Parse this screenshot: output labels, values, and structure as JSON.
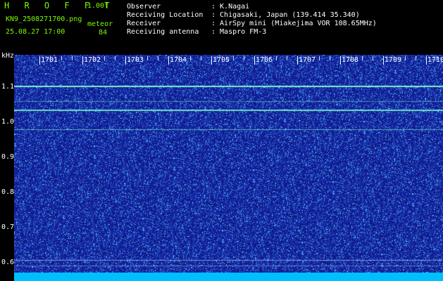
{
  "header": {
    "app_title": "H R O F F T",
    "version": "1.00f",
    "filename": "KN9_2508271700.png",
    "datetime": "25.08.27 17:00",
    "meteor_label": "meteor",
    "meteor_count": "84",
    "info": [
      {
        "label": "Observer",
        "value": ": K.Nagai"
      },
      {
        "label": "Receiving Location",
        "value": ": Chigasaki, Japan (139.414 35.340)"
      },
      {
        "label": "Receiver",
        "value": ": AirSpy mini (Miakejima VOR 108.65MHz)"
      },
      {
        "label": "Receiving antenna",
        "value": ": Maspro FM-3"
      }
    ]
  },
  "axes": {
    "y_unit": "kHz",
    "y_ticks": [
      "1.1",
      "1.0",
      "0.9",
      "0.8",
      "0.7",
      "0.6"
    ],
    "x_ticks": [
      "1701",
      "1702",
      "1703",
      "1704",
      "1705",
      "1706",
      "1707",
      "1708",
      "1709",
      "1710"
    ]
  },
  "colors": {
    "header_text": "#7cfc00",
    "background": "#000000",
    "spectrum_base": "#1a2aa0",
    "carrier_line": "#7fffd4",
    "bottom_strip": "#00bfff"
  }
}
